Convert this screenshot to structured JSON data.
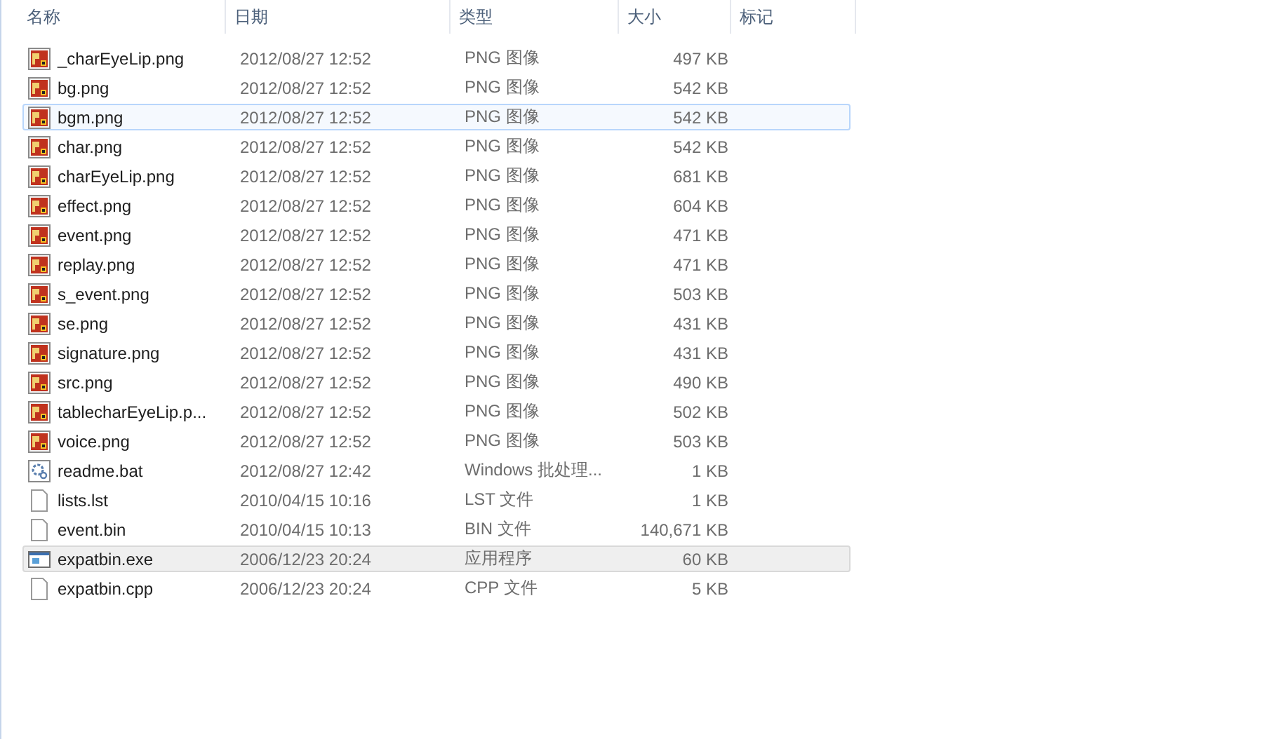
{
  "columns": [
    {
      "label": "名称"
    },
    {
      "label": "日期"
    },
    {
      "label": "类型"
    },
    {
      "label": "大小"
    },
    {
      "label": "标记"
    }
  ],
  "rows": [
    {
      "kind": "image",
      "name": "_charEyeLip.png",
      "date": "2012/08/27 12:52",
      "type": "PNG 图像",
      "size": "497 KB",
      "selected": false,
      "hovered": false
    },
    {
      "kind": "image",
      "name": "bg.png",
      "date": "2012/08/27 12:52",
      "type": "PNG 图像",
      "size": "542 KB",
      "selected": false,
      "hovered": false
    },
    {
      "kind": "image",
      "name": "bgm.png",
      "date": "2012/08/27 12:52",
      "type": "PNG 图像",
      "size": "542 KB",
      "selected": false,
      "hovered": true
    },
    {
      "kind": "image",
      "name": "char.png",
      "date": "2012/08/27 12:52",
      "type": "PNG 图像",
      "size": "542 KB",
      "selected": false,
      "hovered": false
    },
    {
      "kind": "image",
      "name": "charEyeLip.png",
      "date": "2012/08/27 12:52",
      "type": "PNG 图像",
      "size": "681 KB",
      "selected": false,
      "hovered": false
    },
    {
      "kind": "image",
      "name": "effect.png",
      "date": "2012/08/27 12:52",
      "type": "PNG 图像",
      "size": "604 KB",
      "selected": false,
      "hovered": false
    },
    {
      "kind": "image",
      "name": "event.png",
      "date": "2012/08/27 12:52",
      "type": "PNG 图像",
      "size": "471 KB",
      "selected": false,
      "hovered": false
    },
    {
      "kind": "image",
      "name": "replay.png",
      "date": "2012/08/27 12:52",
      "type": "PNG 图像",
      "size": "471 KB",
      "selected": false,
      "hovered": false
    },
    {
      "kind": "image",
      "name": "s_event.png",
      "date": "2012/08/27 12:52",
      "type": "PNG 图像",
      "size": "503 KB",
      "selected": false,
      "hovered": false
    },
    {
      "kind": "image",
      "name": "se.png",
      "date": "2012/08/27 12:52",
      "type": "PNG 图像",
      "size": "431 KB",
      "selected": false,
      "hovered": false
    },
    {
      "kind": "image",
      "name": "signature.png",
      "date": "2012/08/27 12:52",
      "type": "PNG 图像",
      "size": "431 KB",
      "selected": false,
      "hovered": false
    },
    {
      "kind": "image",
      "name": "src.png",
      "date": "2012/08/27 12:52",
      "type": "PNG 图像",
      "size": "490 KB",
      "selected": false,
      "hovered": false
    },
    {
      "kind": "image",
      "name": "tablecharEyeLip.p...",
      "date": "2012/08/27 12:52",
      "type": "PNG 图像",
      "size": "502 KB",
      "selected": false,
      "hovered": false
    },
    {
      "kind": "image",
      "name": "voice.png",
      "date": "2012/08/27 12:52",
      "type": "PNG 图像",
      "size": "503 KB",
      "selected": false,
      "hovered": false
    },
    {
      "kind": "batch",
      "name": "readme.bat",
      "date": "2012/08/27 12:42",
      "type": "Windows 批处理...",
      "size": "1 KB",
      "selected": false,
      "hovered": false
    },
    {
      "kind": "file",
      "name": "lists.lst",
      "date": "2010/04/15 10:16",
      "type": "LST 文件",
      "size": "1 KB",
      "selected": false,
      "hovered": false
    },
    {
      "kind": "file",
      "name": "event.bin",
      "date": "2010/04/15 10:13",
      "type": "BIN 文件",
      "size": "140,671 KB",
      "selected": false,
      "hovered": false
    },
    {
      "kind": "program",
      "name": "expatbin.exe",
      "date": "2006/12/23 20:24",
      "type": "应用程序",
      "size": "60 KB",
      "selected": true,
      "hovered": false
    },
    {
      "kind": "file",
      "name": "expatbin.cpp",
      "date": "2006/12/23 20:24",
      "type": "CPP 文件",
      "size": "5 KB",
      "selected": false,
      "hovered": false
    }
  ]
}
